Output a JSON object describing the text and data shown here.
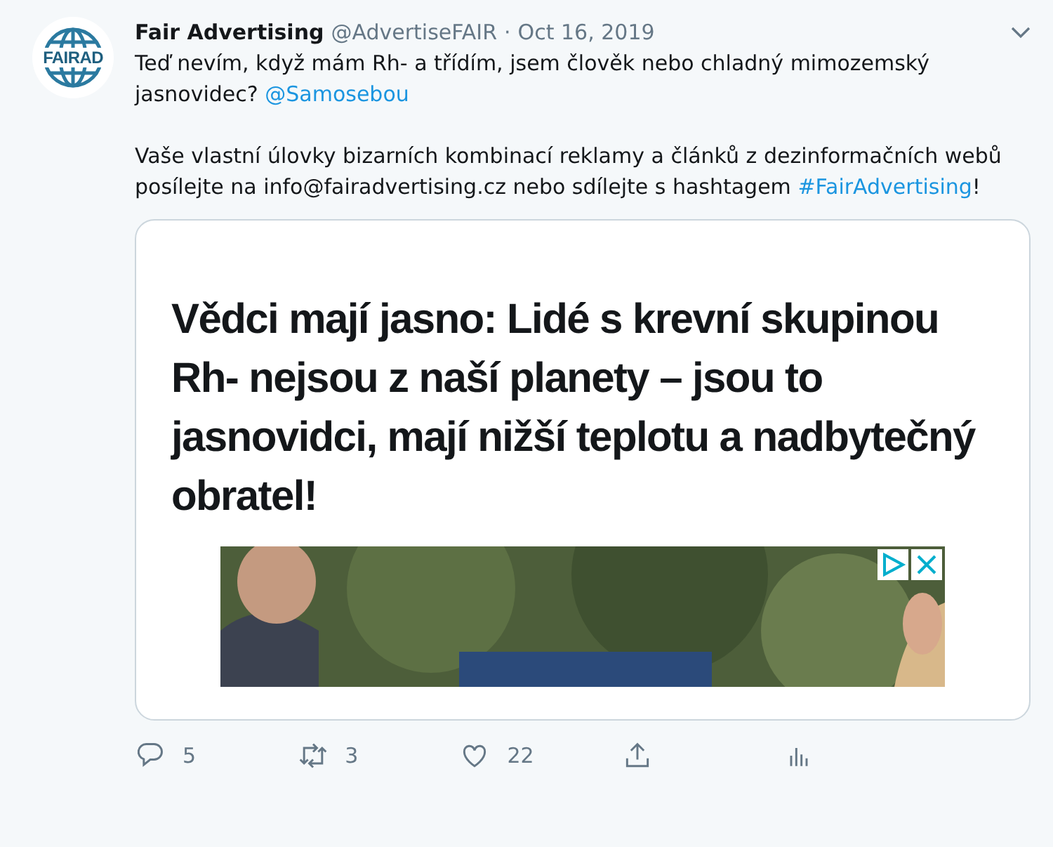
{
  "tweet": {
    "author": "Fair Advertising",
    "handle": "@AdvertiseFAIR",
    "separator": "·",
    "date": "Oct 16, 2019",
    "avatar_text": "FAIRAD",
    "paragraphs": [
      [
        {
          "kind": "text",
          "text": "Teď nevím, když mám Rh- a třídím, jsem člověk nebo chladný mimozemský jasnovidec? "
        },
        {
          "kind": "link",
          "text": "@Samosebou"
        }
      ],
      [
        {
          "kind": "text",
          "text": "Vaše vlastní úlovky bizarních kombinací reklamy a článků z dezinformačních webů posílejte na info@fairadvertising.cz nebo sdílejte s hashtagem "
        },
        {
          "kind": "link",
          "text": "#FairAdvertising"
        },
        {
          "kind": "text",
          "text": "!"
        }
      ]
    ],
    "card": {
      "headline": "Vědci mají jasno: Lidé s krevní skupinou Rh- nejsou z naší planety – jsou to jasnovidci, mají nižší teplotu a nadbytečný obratel!"
    },
    "actions": [
      {
        "kind": "reply",
        "count": "5"
      },
      {
        "kind": "retweet",
        "count": "3"
      },
      {
        "kind": "like",
        "count": "22"
      },
      {
        "kind": "share"
      },
      {
        "kind": "analytics"
      }
    ]
  }
}
